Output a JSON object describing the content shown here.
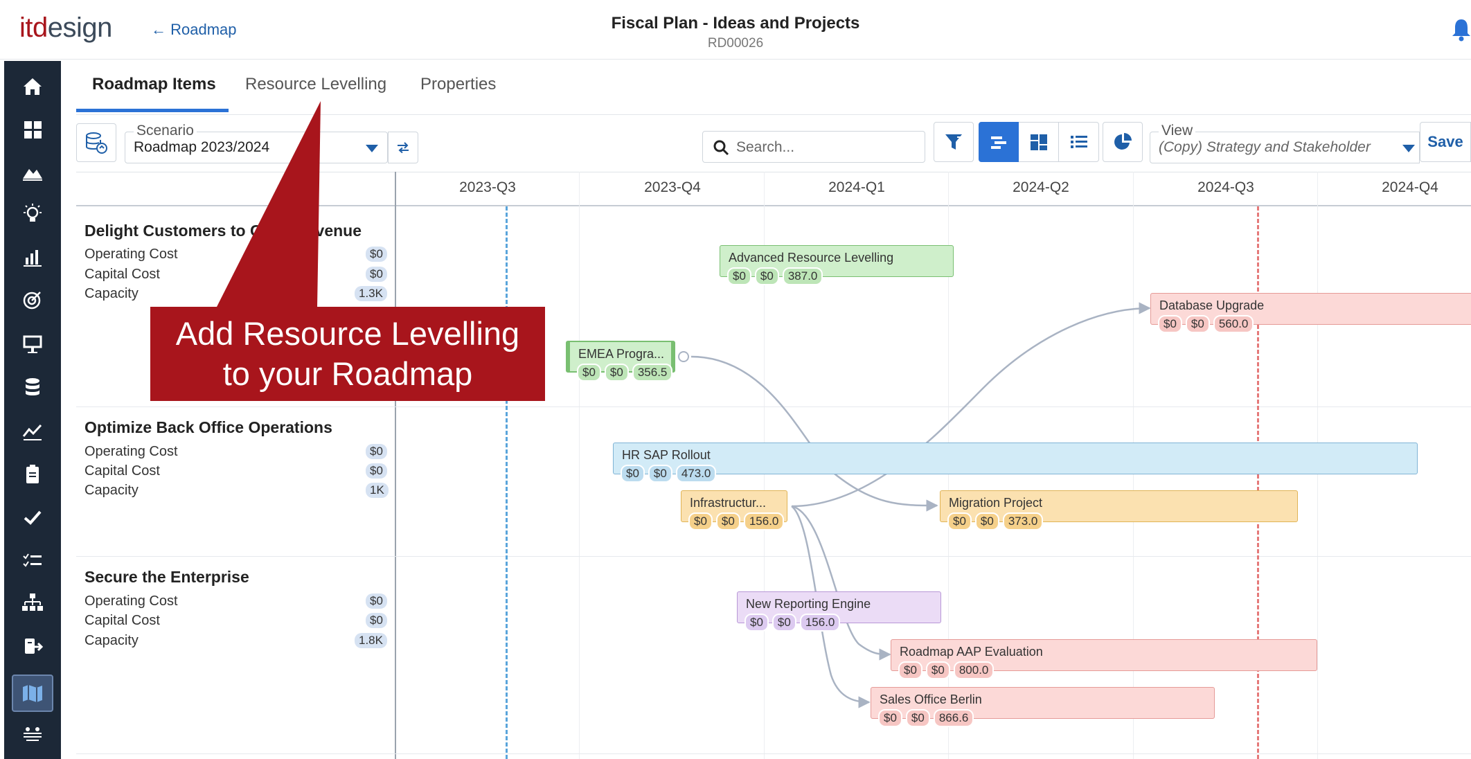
{
  "header": {
    "logo_part1": "itd",
    "logo_part2": "esign",
    "back_link": "← Roadmap",
    "title": "Fiscal Plan - Ideas and Projects",
    "subtitle": "RD00026"
  },
  "tabs": [
    {
      "label": "Roadmap Items",
      "active": true
    },
    {
      "label": "Resource Levelling",
      "active": false
    },
    {
      "label": "Properties",
      "active": false
    }
  ],
  "toolbar": {
    "scenario_legend": "Scenario",
    "scenario_value": "Roadmap 2023/2024",
    "search_placeholder": "Search...",
    "view_legend": "View",
    "view_value": "(Copy) Strategy and Stakeholder",
    "save_label": "Save"
  },
  "timeline": {
    "quarters": [
      "2023-Q3",
      "2023-Q4",
      "2024-Q1",
      "2024-Q2",
      "2024-Q3",
      "2024-Q4"
    ]
  },
  "groups": [
    {
      "title": "Delight Customers to Grow Revenue",
      "metrics": [
        {
          "label": "Operating Cost",
          "value": "$0"
        },
        {
          "label": "Capital Cost",
          "value": "$0"
        },
        {
          "label": "Capacity",
          "value": "1.3K"
        }
      ]
    },
    {
      "title": "Optimize Back Office Operations",
      "metrics": [
        {
          "label": "Operating Cost",
          "value": "$0"
        },
        {
          "label": "Capital Cost",
          "value": "$0"
        },
        {
          "label": "Capacity",
          "value": "1K"
        }
      ]
    },
    {
      "title": "Secure the Enterprise",
      "metrics": [
        {
          "label": "Operating Cost",
          "value": "$0"
        },
        {
          "label": "Capital Cost",
          "value": "$0"
        },
        {
          "label": "Capacity",
          "value": "1.8K"
        }
      ]
    }
  ],
  "items": [
    {
      "name": "Advanced Resource Levelling",
      "op": "$0",
      "cap": "$0",
      "capacity": "387.0"
    },
    {
      "name": "Database Upgrade",
      "op": "$0",
      "cap": "$0",
      "capacity": "560.0"
    },
    {
      "name": "EMEA Progra...",
      "op": "$0",
      "cap": "$0",
      "capacity": "356.5"
    },
    {
      "name": "HR SAP Rollout",
      "op": "$0",
      "cap": "$0",
      "capacity": "473.0"
    },
    {
      "name": "Infrastructur...",
      "op": "$0",
      "cap": "$0",
      "capacity": "156.0"
    },
    {
      "name": "Migration Project",
      "op": "$0",
      "cap": "$0",
      "capacity": "373.0"
    },
    {
      "name": "New Reporting Engine",
      "op": "$0",
      "cap": "$0",
      "capacity": "156.0"
    },
    {
      "name": "Roadmap AAP Evaluation",
      "op": "$0",
      "cap": "$0",
      "capacity": "800.0"
    },
    {
      "name": "Sales Office Berlin",
      "op": "$0",
      "cap": "$0",
      "capacity": "866.6"
    }
  ],
  "callout": {
    "line1": "Add Resource Levelling",
    "line2": "to your Roadmap"
  },
  "colors": {
    "accent": "#2b72d6",
    "sidebar": "#1c2837",
    "callout": "#a8151c"
  },
  "sidebar_icons": [
    "home-icon",
    "dashboard-icon",
    "landscape-icon",
    "idea-icon",
    "chart-icon",
    "target-icon",
    "presentation-icon",
    "database-icon",
    "trend-icon",
    "clipboard-icon",
    "check-icon",
    "checklist-icon",
    "hierarchy-icon",
    "transfer-icon",
    "roadmap-icon",
    "team-icon"
  ]
}
